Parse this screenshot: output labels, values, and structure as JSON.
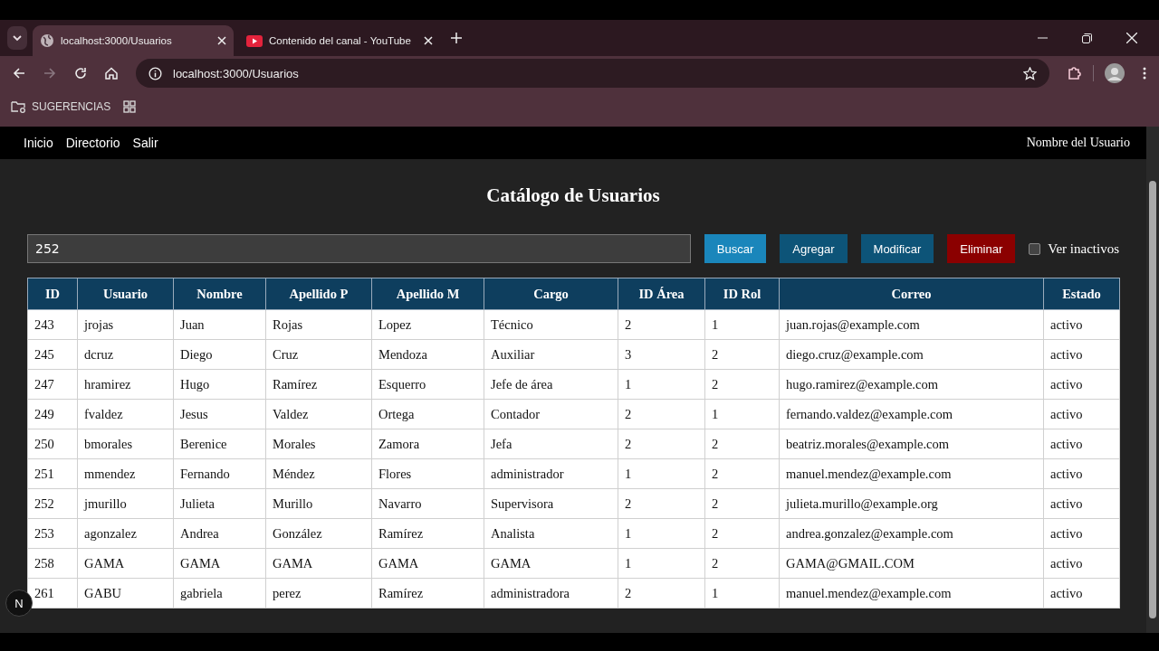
{
  "browser": {
    "tabs": [
      {
        "title": "localhost:3000/Usuarios",
        "kind": "globe",
        "selected": true
      },
      {
        "title": "Contenido del canal - YouTube",
        "kind": "video",
        "selected": false
      }
    ],
    "address": "localhost:3000/Usuarios",
    "bookmarks": [
      {
        "label": "SUGERENCIAS"
      }
    ]
  },
  "nav": {
    "links": [
      "Inicio",
      "Directorio",
      "Salir"
    ],
    "user": "Nombre del Usuario"
  },
  "title": "Catálogo de Usuarios",
  "search": {
    "value": "252"
  },
  "buttons": [
    {
      "label": "Buscar",
      "kind": "search"
    },
    {
      "label": "Agregar",
      "kind": "primary"
    },
    {
      "label": "Modificar",
      "kind": "primary"
    },
    {
      "label": "Eliminar",
      "kind": "danger"
    }
  ],
  "inactive_filter": {
    "label": "Ver inactivos",
    "checked": false
  },
  "table": {
    "columns": [
      "ID",
      "Usuario",
      "Nombre",
      "Apellido P",
      "Apellido M",
      "Cargo",
      "ID Área",
      "ID Rol",
      "Correo",
      "Estado"
    ],
    "rows": [
      [
        "243",
        "jrojas",
        "Juan",
        "Rojas",
        "Lopez",
        "Técnico",
        "2",
        "1",
        "juan.rojas@example.com",
        "activo"
      ],
      [
        "245",
        "dcruz",
        "Diego",
        "Cruz",
        "Mendoza",
        "Auxiliar",
        "3",
        "2",
        "diego.cruz@example.com",
        "activo"
      ],
      [
        "247",
        "hramirez",
        "Hugo",
        "Ramírez",
        "Esquerro",
        "Jefe de área",
        "1",
        "2",
        "hugo.ramirez@example.com",
        "activo"
      ],
      [
        "249",
        "fvaldez",
        "Jesus",
        "Valdez",
        "Ortega",
        "Contador",
        "2",
        "1",
        "fernando.valdez@example.com",
        "activo"
      ],
      [
        "250",
        "bmorales",
        "Berenice",
        "Morales",
        "Zamora",
        "Jefa",
        "2",
        "2",
        "beatriz.morales@example.com",
        "activo"
      ],
      [
        "251",
        "mmendez",
        "Fernando",
        "Méndez",
        "Flores",
        "administrador",
        "1",
        "2",
        "manuel.mendez@example.com",
        "activo"
      ],
      [
        "252",
        "jmurillo",
        "Julieta",
        "Murillo",
        "Navarro",
        "Supervisora",
        "2",
        "2",
        "julieta.murillo@example.org",
        "activo"
      ],
      [
        "253",
        "agonzalez",
        "Andrea",
        "González",
        "Ramírez",
        "Analista",
        "1",
        "2",
        "andrea.gonzalez@example.com",
        "activo"
      ],
      [
        "258",
        "GAMA",
        "GAMA",
        "GAMA",
        "GAMA",
        "GAMA",
        "1",
        "2",
        "GAMA@GMAIL.COM",
        "activo"
      ],
      [
        "261",
        "GABU",
        "gabriela",
        "perez",
        "Ramírez",
        "administradora",
        "2",
        "1",
        "manuel.mendez@example.com",
        "activo"
      ]
    ]
  },
  "dev_badge": "N"
}
